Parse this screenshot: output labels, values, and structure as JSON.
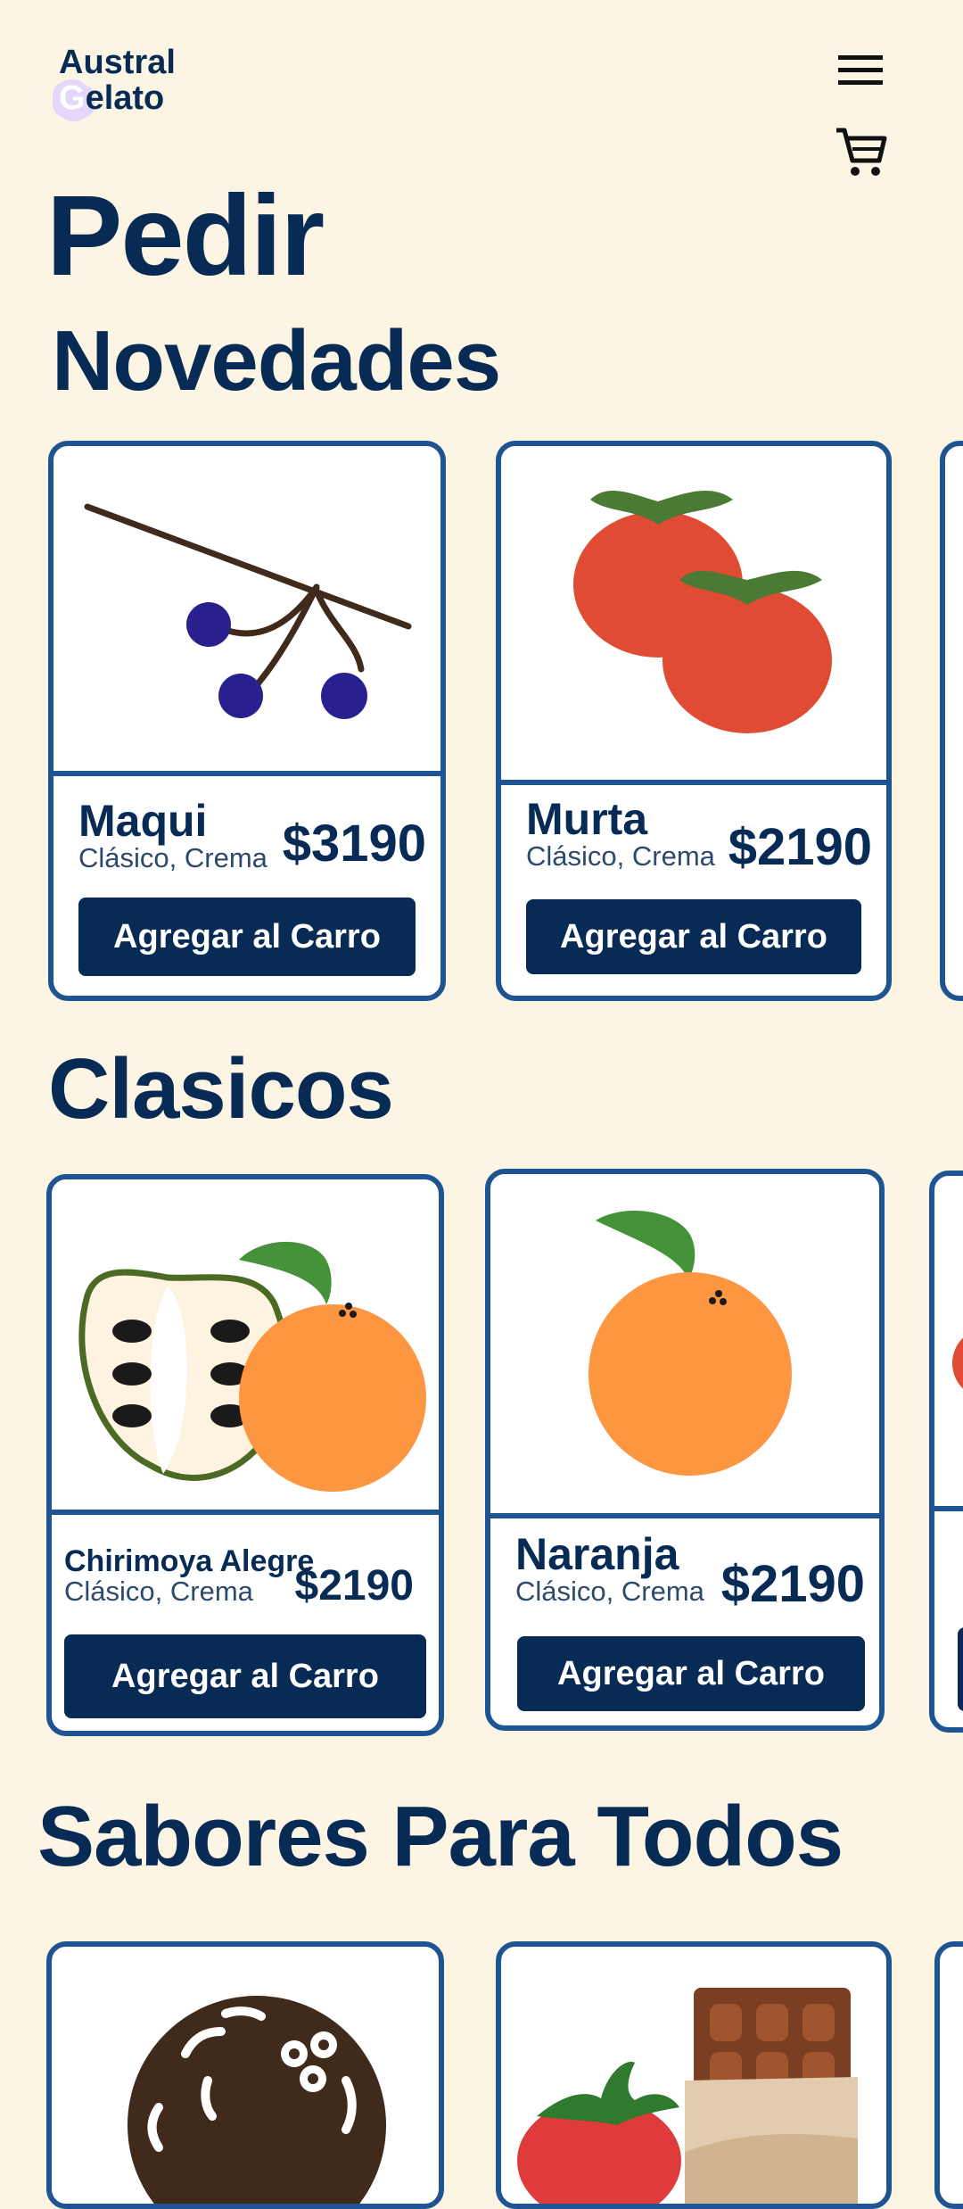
{
  "brand": {
    "line1": "Austral",
    "line2": "elato",
    "letter": "G"
  },
  "header": {
    "menu_icon": "hamburger-menu-icon",
    "cart_icon": "shopping-cart-icon"
  },
  "page": {
    "title": "Pedir"
  },
  "sections": [
    {
      "title": "Novedades",
      "products": [
        {
          "name": "Maqui",
          "desc": "Clásico, Crema",
          "price": "$3190",
          "button": "Agregar al Carro",
          "image": "maqui-berries"
        },
        {
          "name": "Murta",
          "desc": "Clásico, Crema",
          "price": "$2190",
          "button": "Agregar al Carro",
          "image": "murta-fruits"
        }
      ]
    },
    {
      "title": "Clasicos",
      "products": [
        {
          "name": "Chirimoya Alegre",
          "desc": "Clásico, Crema",
          "price": "$2190",
          "button": "Agregar al Carro",
          "image": "chirimoya-orange"
        },
        {
          "name": "Naranja",
          "desc": "Clásico, Crema",
          "price": "$2190",
          "button": "Agregar al Carro",
          "image": "orange-fruit"
        }
      ]
    },
    {
      "title": "Sabores Para Todos",
      "products": [
        {
          "image": "chocolate-cookie"
        },
        {
          "image": "strawberry-chocolate"
        }
      ]
    }
  ],
  "colors": {
    "background": "#fcf5e4",
    "navy": "#072b55",
    "border": "#1f5492",
    "card": "#ffffff"
  }
}
